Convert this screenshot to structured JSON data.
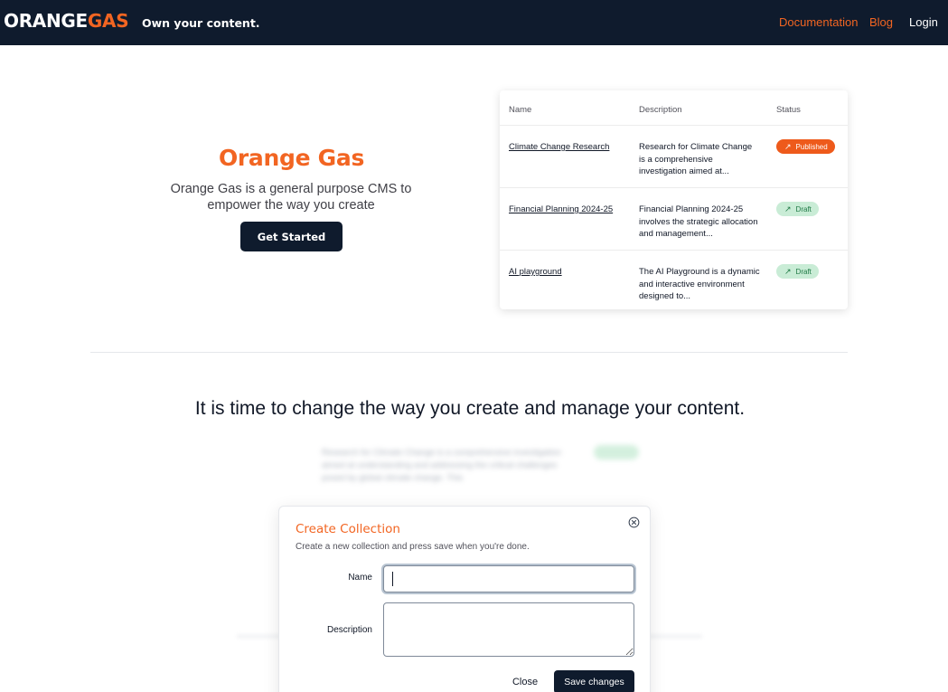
{
  "brand": {
    "part1": "ORANGE",
    "part2": "GAS",
    "tagline": "Own your content."
  },
  "nav": {
    "documentation": "Documentation",
    "blog": "Blog",
    "login": "Login"
  },
  "colors": {
    "accent": "#f26522",
    "navy": "#0f1b2d",
    "published": "#ee5a1b",
    "draft_bg": "#c9ecd6",
    "draft_text": "#1f7a45"
  },
  "hero": {
    "title": "Orange Gas",
    "subtitle": "Orange Gas is a general purpose CMS to empower the way you create",
    "cta": "Get Started"
  },
  "table": {
    "headers": {
      "name": "Name",
      "description": "Description",
      "status": "Status"
    },
    "rows": [
      {
        "name": "Climate Change Research",
        "description": "Research for Climate Change is a comprehensive investigation aimed at...",
        "status": "Published",
        "status_icon": "arrow-up-right-icon"
      },
      {
        "name": "Financial Planning 2024-25",
        "description": "Financial Planning 2024-25 involves the strategic allocation and management...",
        "status": "Draft",
        "status_icon": "arrow-up-right-icon"
      },
      {
        "name": "AI playground",
        "description": "The AI Playground is a dynamic and interactive environment designed to...",
        "status": "Draft",
        "status_icon": "arrow-up-right-icon"
      }
    ]
  },
  "section": {
    "headline": "It is time to change the way you create and manage your content."
  },
  "background_blur_text": "Research for Climate Change is a comprehensive investigation aimed at understanding and addressing the critical challenges posed by global climate change. This",
  "dialog": {
    "title": "Create Collection",
    "subtitle": "Create a new collection and press save when you're done.",
    "name_label": "Name",
    "name_value": "",
    "description_label": "Description",
    "description_value": "",
    "close_label": "Close",
    "save_label": "Save changes",
    "close_icon": "close-circle-icon"
  }
}
